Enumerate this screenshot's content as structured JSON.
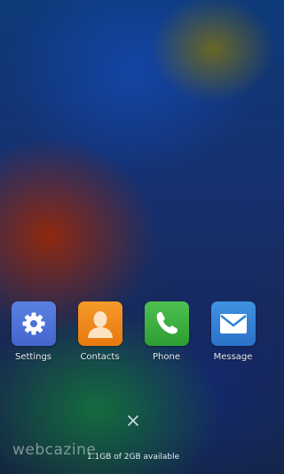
{
  "apps": [
    {
      "label": "Settings",
      "icon": "gear-icon",
      "color": "#4d73d8"
    },
    {
      "label": "Contacts",
      "icon": "contact-person-icon",
      "color": "#f08a1c"
    },
    {
      "label": "Phone",
      "icon": "phone-handset-icon",
      "color": "#3aac3c"
    },
    {
      "label": "Message",
      "icon": "envelope-icon",
      "color": "#2f82d6"
    }
  ],
  "close_icon": "close-icon",
  "memory_text": "1.1GB of 2GB available",
  "watermark": "webcazine"
}
